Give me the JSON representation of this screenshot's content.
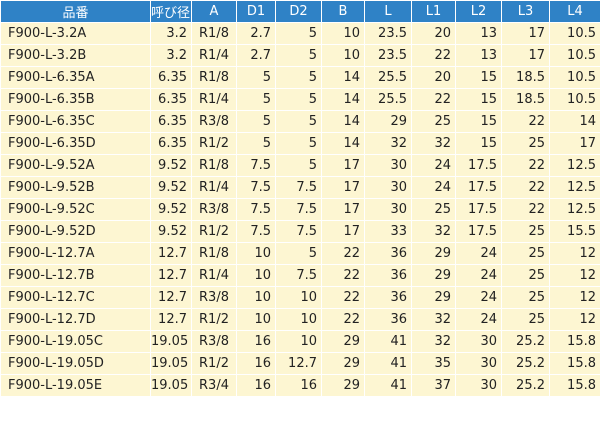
{
  "header_color": "#2f82c6",
  "row_color": "#fdf6d2",
  "columns": [
    "品番",
    "呼び径D",
    "A",
    "D1",
    "D2",
    "B",
    "L",
    "L1",
    "L2",
    "L3",
    "L4"
  ],
  "rows": [
    [
      "F900-L-3.2A",
      "3.2",
      "R1/8",
      "2.7",
      "5",
      "10",
      "23.5",
      "20",
      "13",
      "17",
      "10.5"
    ],
    [
      "F900-L-3.2B",
      "3.2",
      "R1/4",
      "2.7",
      "5",
      "10",
      "23.5",
      "22",
      "13",
      "17",
      "10.5"
    ],
    [
      "F900-L-6.35A",
      "6.35",
      "R1/8",
      "5",
      "5",
      "14",
      "25.5",
      "20",
      "15",
      "18.5",
      "10.5"
    ],
    [
      "F900-L-6.35B",
      "6.35",
      "R1/4",
      "5",
      "5",
      "14",
      "25.5",
      "22",
      "15",
      "18.5",
      "10.5"
    ],
    [
      "F900-L-6.35C",
      "6.35",
      "R3/8",
      "5",
      "5",
      "14",
      "29",
      "25",
      "15",
      "22",
      "14"
    ],
    [
      "F900-L-6.35D",
      "6.35",
      "R1/2",
      "5",
      "5",
      "14",
      "32",
      "32",
      "15",
      "25",
      "17"
    ],
    [
      "F900-L-9.52A",
      "9.52",
      "R1/8",
      "7.5",
      "5",
      "17",
      "30",
      "24",
      "17.5",
      "22",
      "12.5"
    ],
    [
      "F900-L-9.52B",
      "9.52",
      "R1/4",
      "7.5",
      "7.5",
      "17",
      "30",
      "24",
      "17.5",
      "22",
      "12.5"
    ],
    [
      "F900-L-9.52C",
      "9.52",
      "R3/8",
      "7.5",
      "7.5",
      "17",
      "30",
      "25",
      "17.5",
      "22",
      "12.5"
    ],
    [
      "F900-L-9.52D",
      "9.52",
      "R1/2",
      "7.5",
      "7.5",
      "17",
      "33",
      "32",
      "17.5",
      "25",
      "15.5"
    ],
    [
      "F900-L-12.7A",
      "12.7",
      "R1/8",
      "10",
      "5",
      "22",
      "36",
      "29",
      "24",
      "25",
      "12"
    ],
    [
      "F900-L-12.7B",
      "12.7",
      "R1/4",
      "10",
      "7.5",
      "22",
      "36",
      "29",
      "24",
      "25",
      "12"
    ],
    [
      "F900-L-12.7C",
      "12.7",
      "R3/8",
      "10",
      "10",
      "22",
      "36",
      "29",
      "24",
      "25",
      "12"
    ],
    [
      "F900-L-12.7D",
      "12.7",
      "R1/2",
      "10",
      "10",
      "22",
      "36",
      "32",
      "24",
      "25",
      "12"
    ],
    [
      "F900-L-19.05C",
      "19.05",
      "R3/8",
      "16",
      "10",
      "29",
      "41",
      "32",
      "30",
      "25.2",
      "15.8"
    ],
    [
      "F900-L-19.05D",
      "19.05",
      "R1/2",
      "16",
      "12.7",
      "29",
      "41",
      "35",
      "30",
      "25.2",
      "15.8"
    ],
    [
      "F900-L-19.05E",
      "19.05",
      "R3/4",
      "16",
      "16",
      "29",
      "41",
      "37",
      "30",
      "25.2",
      "15.8"
    ]
  ]
}
